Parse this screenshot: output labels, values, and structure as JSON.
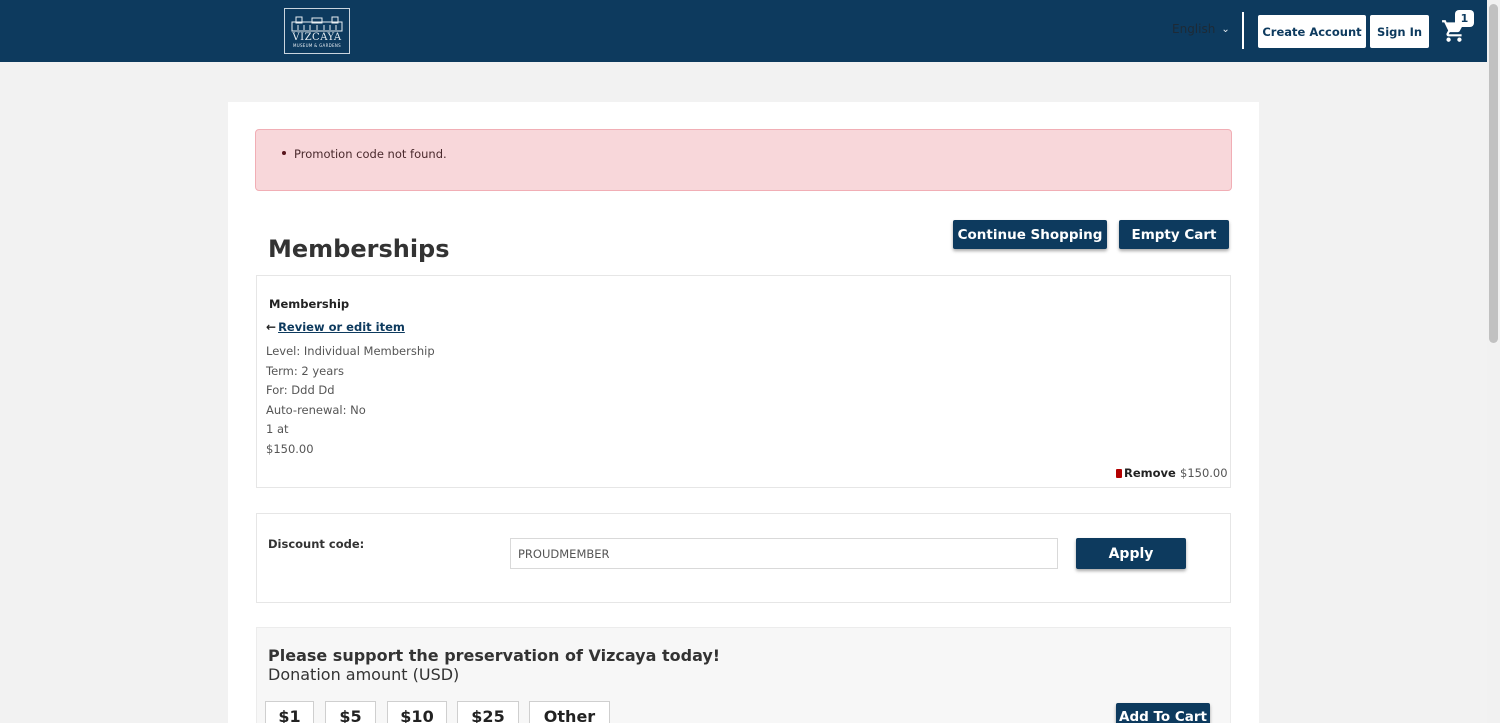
{
  "header": {
    "logo": {
      "name": "VIZCAYA",
      "sub": "MUSEUM & GARDENS"
    },
    "language": "English",
    "create_account": "Create Account",
    "sign_in": "Sign In",
    "cart_count": "1"
  },
  "alert": {
    "message": "Promotion code not found."
  },
  "page": {
    "title": "Memberships",
    "continue_shopping": "Continue Shopping",
    "empty_cart": "Empty Cart"
  },
  "item": {
    "type": "Membership",
    "review_link": "Review or edit item",
    "details": [
      "Level: Individual Membership",
      "Term: 2 years",
      "For: Ddd Dd",
      "Auto-renewal: No",
      "1 at",
      "$150.00"
    ],
    "remove": "Remove",
    "price": "$150.00"
  },
  "discount": {
    "label": "Discount code:",
    "value": "PROUDMEMBER",
    "apply": "Apply"
  },
  "donation": {
    "title": "Please support the preservation of Vizcaya today!",
    "amount_label": "Donation amount (USD)",
    "amounts": [
      "$1",
      "$5",
      "$10",
      "$25",
      "Other"
    ],
    "add_to_cart": "Add To Cart"
  }
}
